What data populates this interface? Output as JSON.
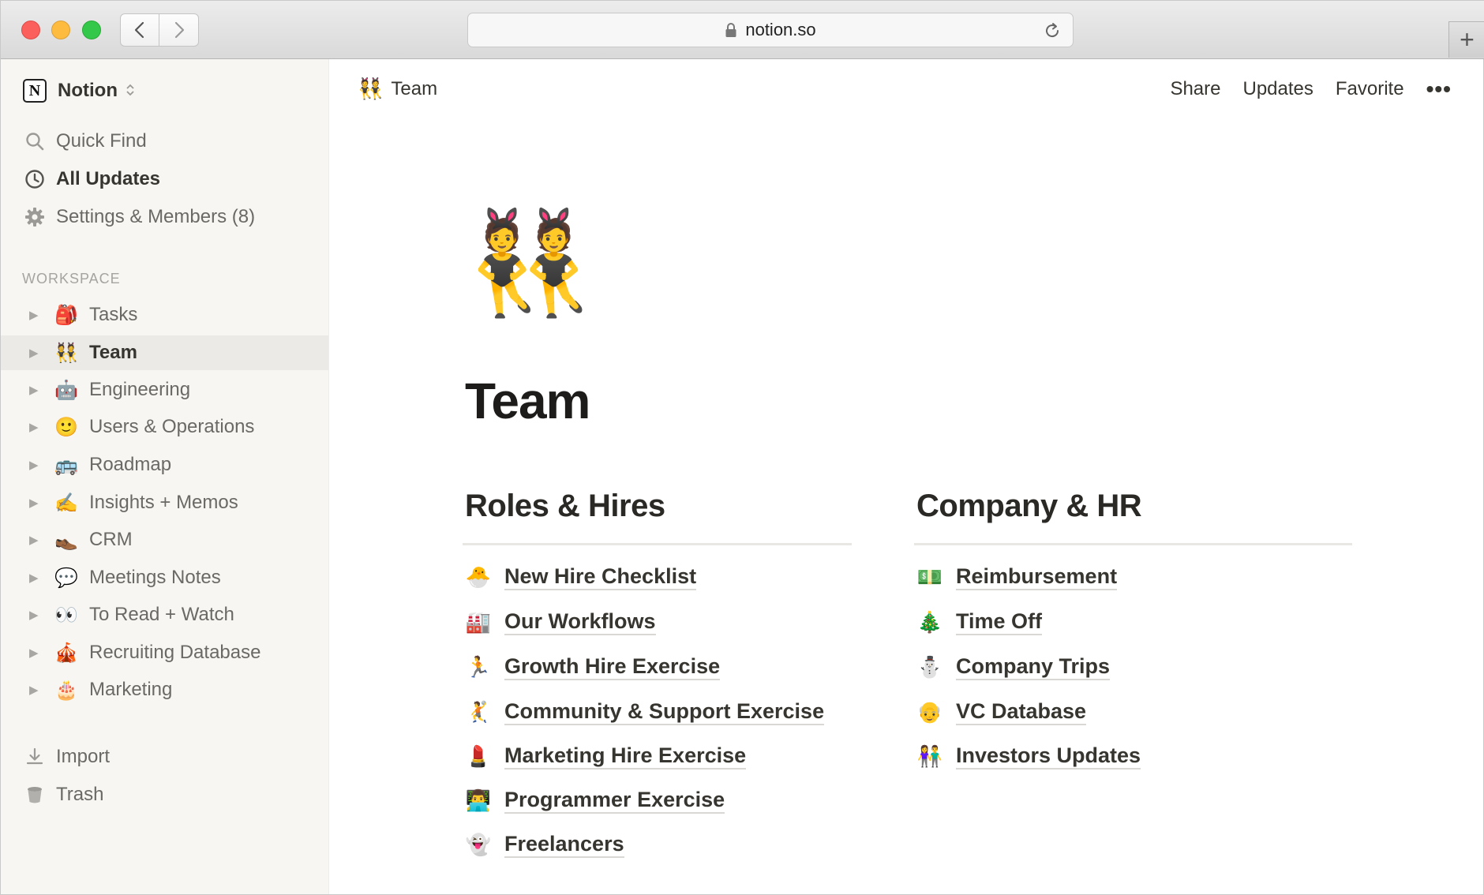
{
  "browser": {
    "url": "notion.so",
    "new_tab_label": "+"
  },
  "sidebar": {
    "workspace_name": "Notion",
    "logo_letter": "N",
    "chevron": "⌃⌄",
    "top_items": [
      {
        "label": "Quick Find",
        "icon": "search-icon"
      },
      {
        "label": "All Updates",
        "icon": "clock-icon"
      },
      {
        "label": "Settings & Members (8)",
        "icon": "gear-icon"
      }
    ],
    "section_heading": "WORKSPACE",
    "pages": [
      {
        "emoji": "🎒",
        "label": "Tasks"
      },
      {
        "emoji": "👯",
        "label": "Team"
      },
      {
        "emoji": "🤖",
        "label": "Engineering"
      },
      {
        "emoji": "🙂",
        "label": "Users & Operations"
      },
      {
        "emoji": "🚌",
        "label": "Roadmap"
      },
      {
        "emoji": "✍️",
        "label": "Insights + Memos"
      },
      {
        "emoji": "👞",
        "label": "CRM"
      },
      {
        "emoji": "💬",
        "label": "Meetings Notes"
      },
      {
        "emoji": "👀",
        "label": "To Read + Watch"
      },
      {
        "emoji": "🎪",
        "label": "Recruiting Database"
      },
      {
        "emoji": "🎂",
        "label": "Marketing"
      }
    ],
    "active_page": "Team",
    "bottom_items": [
      {
        "label": "Import",
        "icon": "download-icon"
      },
      {
        "label": "Trash",
        "icon": "trash-icon"
      }
    ]
  },
  "topbar": {
    "breadcrumb_emoji": "👯",
    "breadcrumb_label": "Team",
    "share": "Share",
    "updates": "Updates",
    "favorite": "Favorite",
    "more": "•••"
  },
  "page": {
    "icon": "👯",
    "title": "Team",
    "columns": [
      {
        "heading": "Roles & Hires",
        "links": [
          {
            "emoji": "🐣",
            "label": "New Hire Checklist"
          },
          {
            "emoji": "🏭",
            "label": "Our Workflows"
          },
          {
            "emoji": "🏃",
            "label": "Growth Hire Exercise"
          },
          {
            "emoji": "🤾",
            "label": "Community & Support Exercise"
          },
          {
            "emoji": "💄",
            "label": "Marketing Hire Exercise"
          },
          {
            "emoji": "👨‍💻",
            "label": "Programmer Exercise"
          },
          {
            "emoji": "👻",
            "label": "Freelancers"
          }
        ]
      },
      {
        "heading": "Company & HR",
        "links": [
          {
            "emoji": "💵",
            "label": "Reimbursement"
          },
          {
            "emoji": "🎄",
            "label": "Time Off"
          },
          {
            "emoji": "⛄",
            "label": "Company Trips"
          },
          {
            "emoji": "👴",
            "label": "VC Database"
          },
          {
            "emoji": "👫",
            "label": "Investors Updates"
          }
        ]
      }
    ]
  }
}
